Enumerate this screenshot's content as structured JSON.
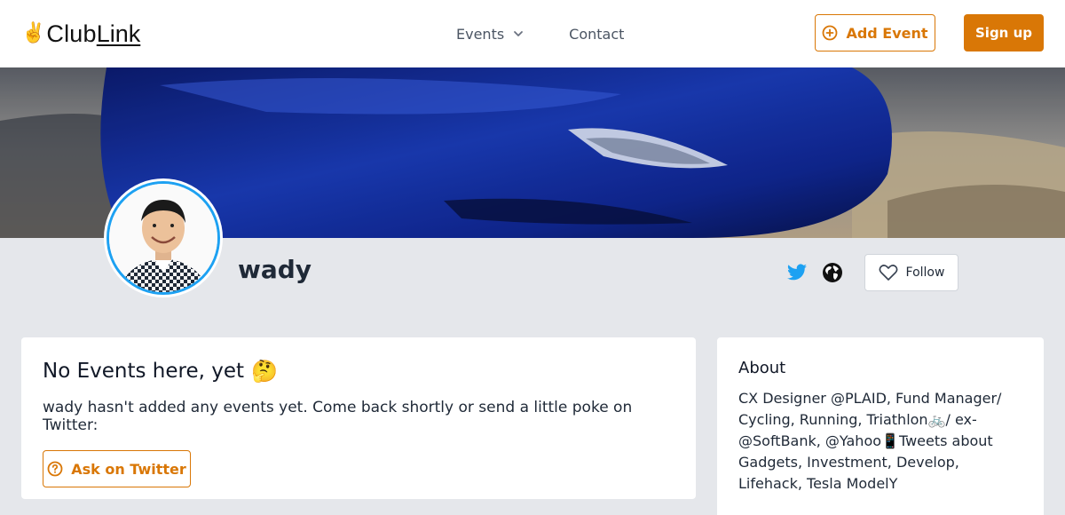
{
  "header": {
    "logo_emoji": "✌️",
    "logo_club": "Club",
    "logo_link": "Link",
    "nav": {
      "events_label": "Events",
      "contact_label": "Contact"
    },
    "add_event_label": "Add Event",
    "signup_label": "Sign up"
  },
  "profile": {
    "username": "wady",
    "follow_label": "Follow"
  },
  "events_card": {
    "title": "No Events here, yet",
    "title_emoji": "🤔",
    "message": "wady hasn't added any events yet. Come back shortly or send a little poke on Twitter:",
    "ask_label": "Ask on Twitter"
  },
  "about_card": {
    "title": "About",
    "bio": "CX Designer @PLAID, Fund Manager/ Cycling, Running, Triathlon🚲/ ex-@SoftBank, @Yahoo📱Tweets about Gadgets, Investment, Develop, Lifehack, Tesla ModelY"
  },
  "colors": {
    "accent": "#d97706",
    "twitter": "#1da1f2",
    "page_bg": "#e5e7eb"
  },
  "icons": {
    "add": "plus-circle-icon",
    "chevron": "chevron-down-icon",
    "twitter": "twitter-icon",
    "globe": "globe-icon",
    "heart": "heart-icon",
    "help": "question-circle-icon"
  }
}
